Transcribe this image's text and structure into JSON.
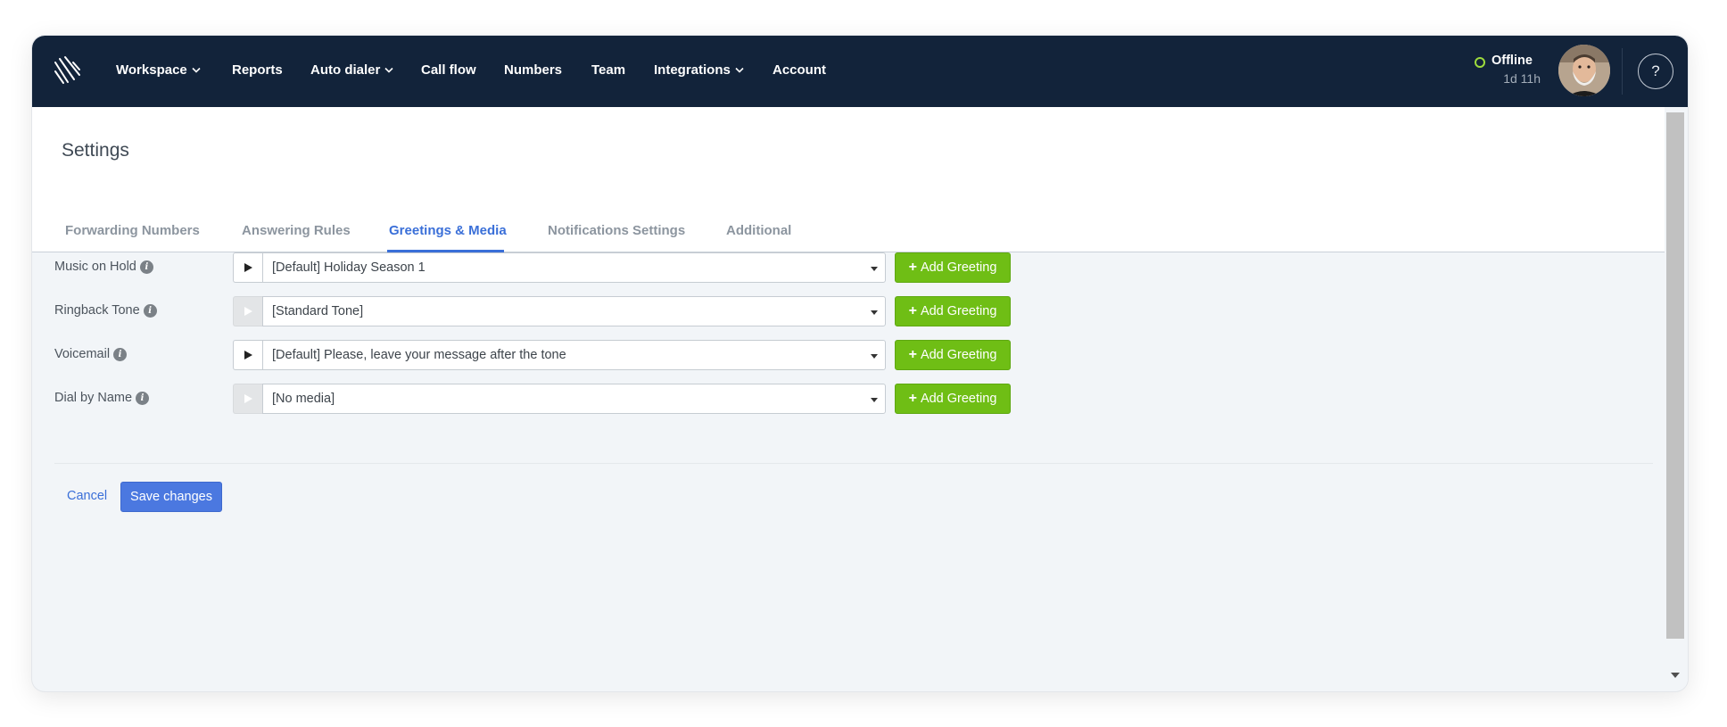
{
  "nav": {
    "items": [
      {
        "label": "Workspace",
        "dropdown": true
      },
      {
        "label": "Reports",
        "dropdown": false
      },
      {
        "label": "Auto dialer",
        "dropdown": true
      },
      {
        "label": "Call flow",
        "dropdown": false
      },
      {
        "label": "Numbers",
        "dropdown": false
      },
      {
        "label": "Team",
        "dropdown": false
      },
      {
        "label": "Integrations",
        "dropdown": true
      },
      {
        "label": "Account",
        "dropdown": false
      }
    ],
    "status_label": "Offline",
    "status_time": "1d 11h",
    "status_color": "#9ddb3c",
    "help_icon": "?"
  },
  "page": {
    "title": "Settings",
    "tabs": [
      {
        "label": "Forwarding Numbers",
        "active": false
      },
      {
        "label": "Answering Rules",
        "active": false
      },
      {
        "label": "Greetings & Media",
        "active": true
      },
      {
        "label": "Notifications Settings",
        "active": false
      },
      {
        "label": "Additional",
        "active": false
      }
    ]
  },
  "media": {
    "rows": [
      {
        "label": "Music on Hold",
        "value": "[Default] Holiday Season 1",
        "play_enabled": true,
        "button": "Add Greeting"
      },
      {
        "label": "Ringback Tone",
        "value": "[Standard Tone]",
        "play_enabled": false,
        "button": "Add Greeting"
      },
      {
        "label": "Voicemail",
        "value": "[Default] Please, leave your message after the tone",
        "play_enabled": true,
        "button": "Add Greeting"
      },
      {
        "label": "Dial by Name",
        "value": "[No media]",
        "play_enabled": false,
        "button": "Add Greeting"
      }
    ]
  },
  "actions": {
    "cancel": "Cancel",
    "save": "Save changes"
  },
  "colors": {
    "navbar": "#12233a",
    "accent": "#3a6fd8",
    "add_button": "#6fbe15",
    "save_button": "#4b78e0"
  }
}
